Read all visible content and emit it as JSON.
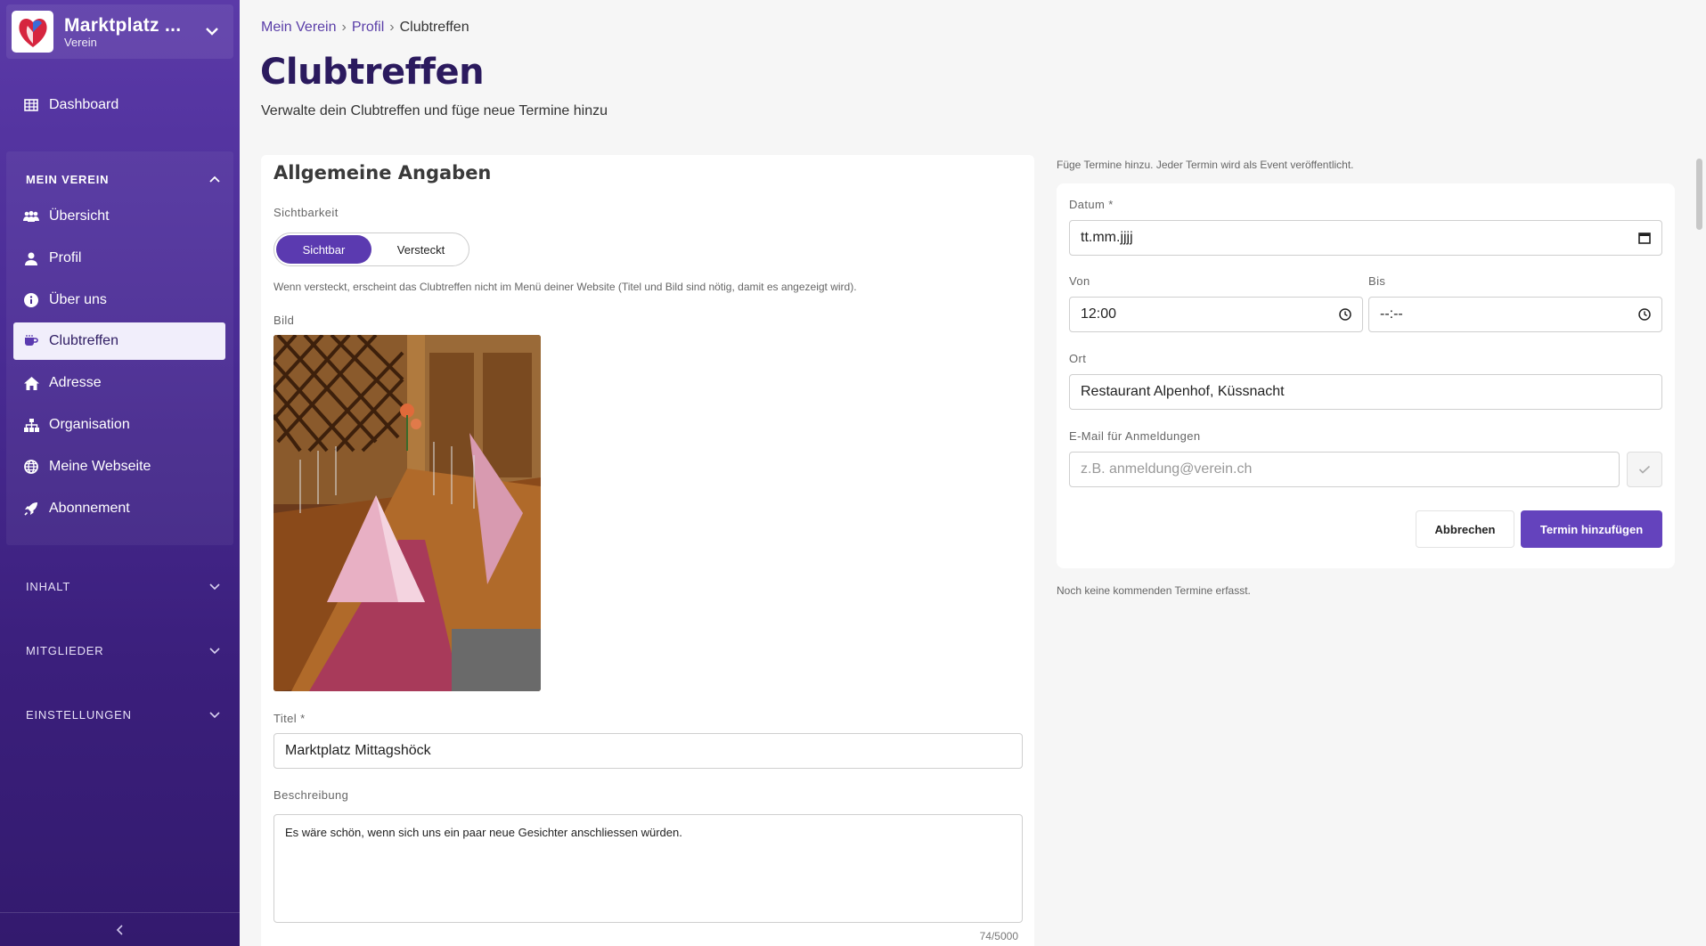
{
  "sidebar": {
    "brand_title": "Marktplatz ...",
    "brand_sub": "Verein",
    "dashboard": "Dashboard",
    "section_mein_verein": "MEIN VEREIN",
    "items": [
      {
        "label": "Übersicht",
        "icon": "users-icon"
      },
      {
        "label": "Profil",
        "icon": "user-icon"
      },
      {
        "label": "Über uns",
        "icon": "info-icon"
      },
      {
        "label": "Clubtreffen",
        "icon": "coffee-icon"
      },
      {
        "label": "Adresse",
        "icon": "home-icon"
      },
      {
        "label": "Organisation",
        "icon": "sitemap-icon"
      },
      {
        "label": "Meine Webseite",
        "icon": "globe-icon"
      },
      {
        "label": "Abonnement",
        "icon": "rocket-icon"
      }
    ],
    "section_inhalt": "INHALT",
    "section_mitglieder": "MITGLIEDER",
    "section_einstellungen": "EINSTELLUNGEN"
  },
  "breadcrumb": {
    "a": "Mein Verein",
    "b": "Profil",
    "c": "Clubtreffen"
  },
  "page": {
    "title": "Clubtreffen",
    "subtitle": "Verwalte dein Clubtreffen und füge neue Termine hinzu"
  },
  "general": {
    "heading": "Allgemeine Angaben",
    "visibility_label": "Sichtbarkeit",
    "visible": "Sichtbar",
    "hidden": "Versteckt",
    "visibility_hint": "Wenn versteckt, erscheint das Clubtreffen nicht im Menü deiner Website (Titel und Bild sind nötig, damit es angezeigt wird).",
    "image_label": "Bild",
    "title_label": "Titel *",
    "title_value": "Marktplatz Mittagshöck",
    "desc_label": "Beschreibung",
    "desc_value": "Es wäre schön, wenn sich uns ein paar neue Gesichter anschliessen würden.",
    "counter": "74/5000"
  },
  "termine": {
    "hint": "Füge Termine hinzu. Jeder Termin wird als Event veröffentlicht.",
    "date_label": "Datum *",
    "date_value": "tt.mm.jjjj",
    "from_label": "Von",
    "from_value": "12:00",
    "to_label": "Bis",
    "to_value": "--:--",
    "place_label": "Ort",
    "place_value": "Restaurant Alpenhof, Küssnacht",
    "email_label": "E-Mail für Anmeldungen",
    "email_placeholder": "z.B. anmeldung@verein.ch",
    "cancel": "Abbrechen",
    "add": "Termin hinzufügen",
    "none": "Noch keine kommenden Termine erfasst."
  },
  "colors": {
    "accent": "#6443bd",
    "sidebar": "#4a2c95",
    "title": "#2b1a5e"
  }
}
